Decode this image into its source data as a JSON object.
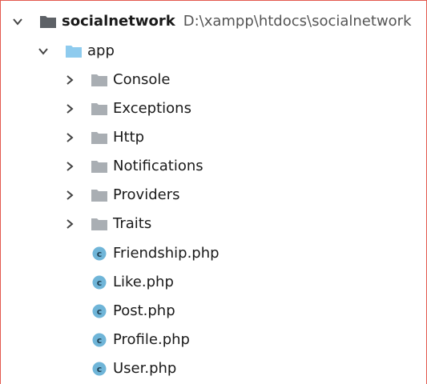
{
  "tree": {
    "root": {
      "name": "socialnetwork",
      "path": "D:\\xampp\\htdocs\\socialnetwork",
      "icon": "folder-icon",
      "expanded": true
    },
    "app": {
      "name": "app",
      "icon": "folder-icon",
      "expanded": true
    },
    "folders": [
      {
        "name": "Console",
        "icon": "folder-icon",
        "expanded": false
      },
      {
        "name": "Exceptions",
        "icon": "folder-icon",
        "expanded": false
      },
      {
        "name": "Http",
        "icon": "folder-icon",
        "expanded": false
      },
      {
        "name": "Notifications",
        "icon": "folder-icon",
        "expanded": false
      },
      {
        "name": "Providers",
        "icon": "folder-icon",
        "expanded": false
      },
      {
        "name": "Traits",
        "icon": "folder-icon",
        "expanded": false
      }
    ],
    "files": [
      {
        "name": "Friendship.php",
        "icon": "php-class-icon"
      },
      {
        "name": "Like.php",
        "icon": "php-class-icon"
      },
      {
        "name": "Post.php",
        "icon": "php-class-icon"
      },
      {
        "name": "Profile.php",
        "icon": "php-class-icon"
      },
      {
        "name": "User.php",
        "icon": "php-class-icon"
      }
    ]
  },
  "colors": {
    "folder_gray": "#a9aeb3",
    "folder_blue": "#8ecbee",
    "root_folder": "#5d6166",
    "class_badge": "#6fb5d8",
    "border": "#e35a4f",
    "chevron": "#444444"
  }
}
